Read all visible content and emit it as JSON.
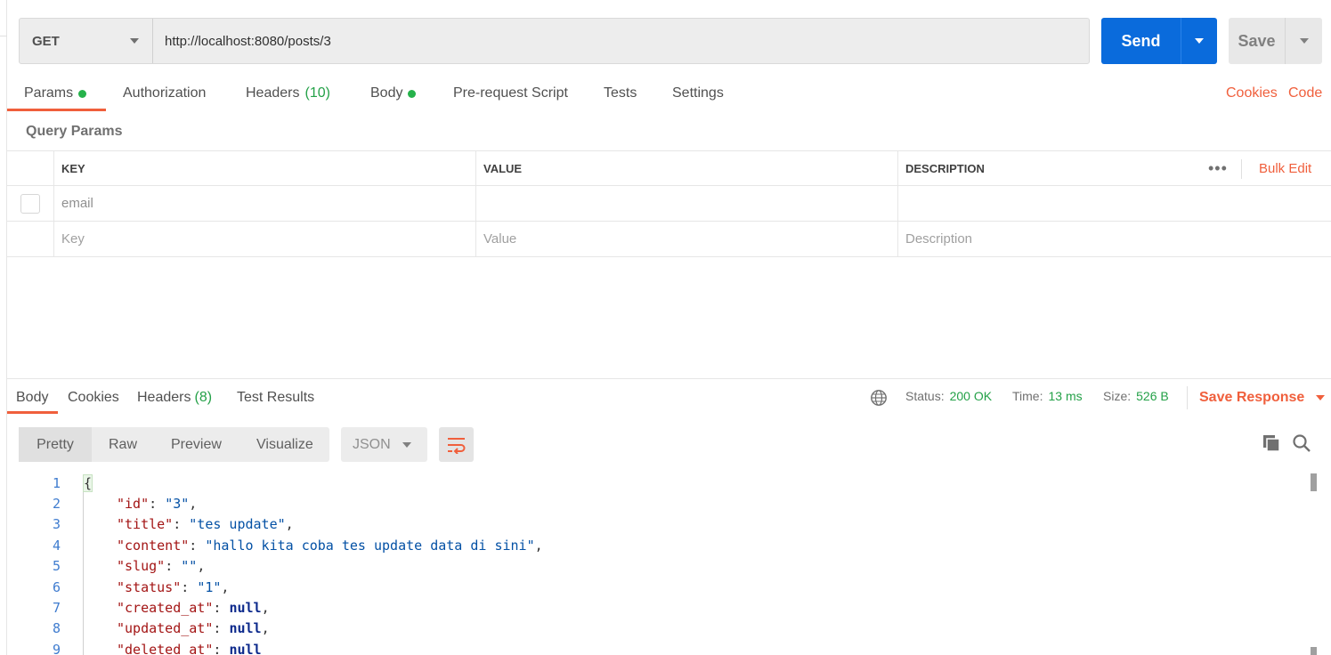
{
  "request": {
    "method": "GET",
    "url": "http://localhost:8080/posts/3",
    "send_label": "Send",
    "save_label": "Save"
  },
  "request_tabs": {
    "params": "Params",
    "authorization": "Authorization",
    "headers": "Headers",
    "headers_count": "(10)",
    "body": "Body",
    "prerequest": "Pre-request Script",
    "tests": "Tests",
    "settings": "Settings",
    "cookies": "Cookies",
    "code": "Code"
  },
  "query_params": {
    "title": "Query Params",
    "columns": {
      "key": "KEY",
      "value": "VALUE",
      "description": "DESCRIPTION"
    },
    "more_label": "•••",
    "bulk_edit": "Bulk Edit",
    "rows": [
      {
        "key": "email",
        "value": "",
        "description": ""
      }
    ],
    "placeholders": {
      "key": "Key",
      "value": "Value",
      "description": "Description"
    }
  },
  "response": {
    "tabs": {
      "body": "Body",
      "cookies": "Cookies",
      "headers": "Headers",
      "headers_count": "(8)",
      "test_results": "Test Results"
    },
    "status_label": "Status:",
    "status_value": "200 OK",
    "time_label": "Time:",
    "time_value": "13 ms",
    "size_label": "Size:",
    "size_value": "526 B",
    "save_response": "Save Response",
    "views": {
      "pretty": "Pretty",
      "raw": "Raw",
      "preview": "Preview",
      "visualize": "Visualize"
    },
    "format": "JSON",
    "line_numbers": [
      "1",
      "2",
      "3",
      "4",
      "5",
      "6",
      "7",
      "8",
      "9"
    ],
    "fields": [
      {
        "key": "\"id\"",
        "value": "\"3\"",
        "type": "string"
      },
      {
        "key": "\"title\"",
        "value": "\"tes update\"",
        "type": "string"
      },
      {
        "key": "\"content\"",
        "value": "\"hallo kita coba tes update data di sini\"",
        "type": "string"
      },
      {
        "key": "\"slug\"",
        "value": "\"\"",
        "type": "string"
      },
      {
        "key": "\"status\"",
        "value": "\"1\"",
        "type": "string"
      },
      {
        "key": "\"created_at\"",
        "value": "null",
        "type": "null"
      },
      {
        "key": "\"updated_at\"",
        "value": "null",
        "type": "null"
      },
      {
        "key": "\"deleted_at\"",
        "value": "null",
        "type": "null"
      }
    ]
  },
  "colors": {
    "accent": "#f05f3c",
    "send_blue": "#0a6bdc",
    "success_green": "#24a148"
  }
}
